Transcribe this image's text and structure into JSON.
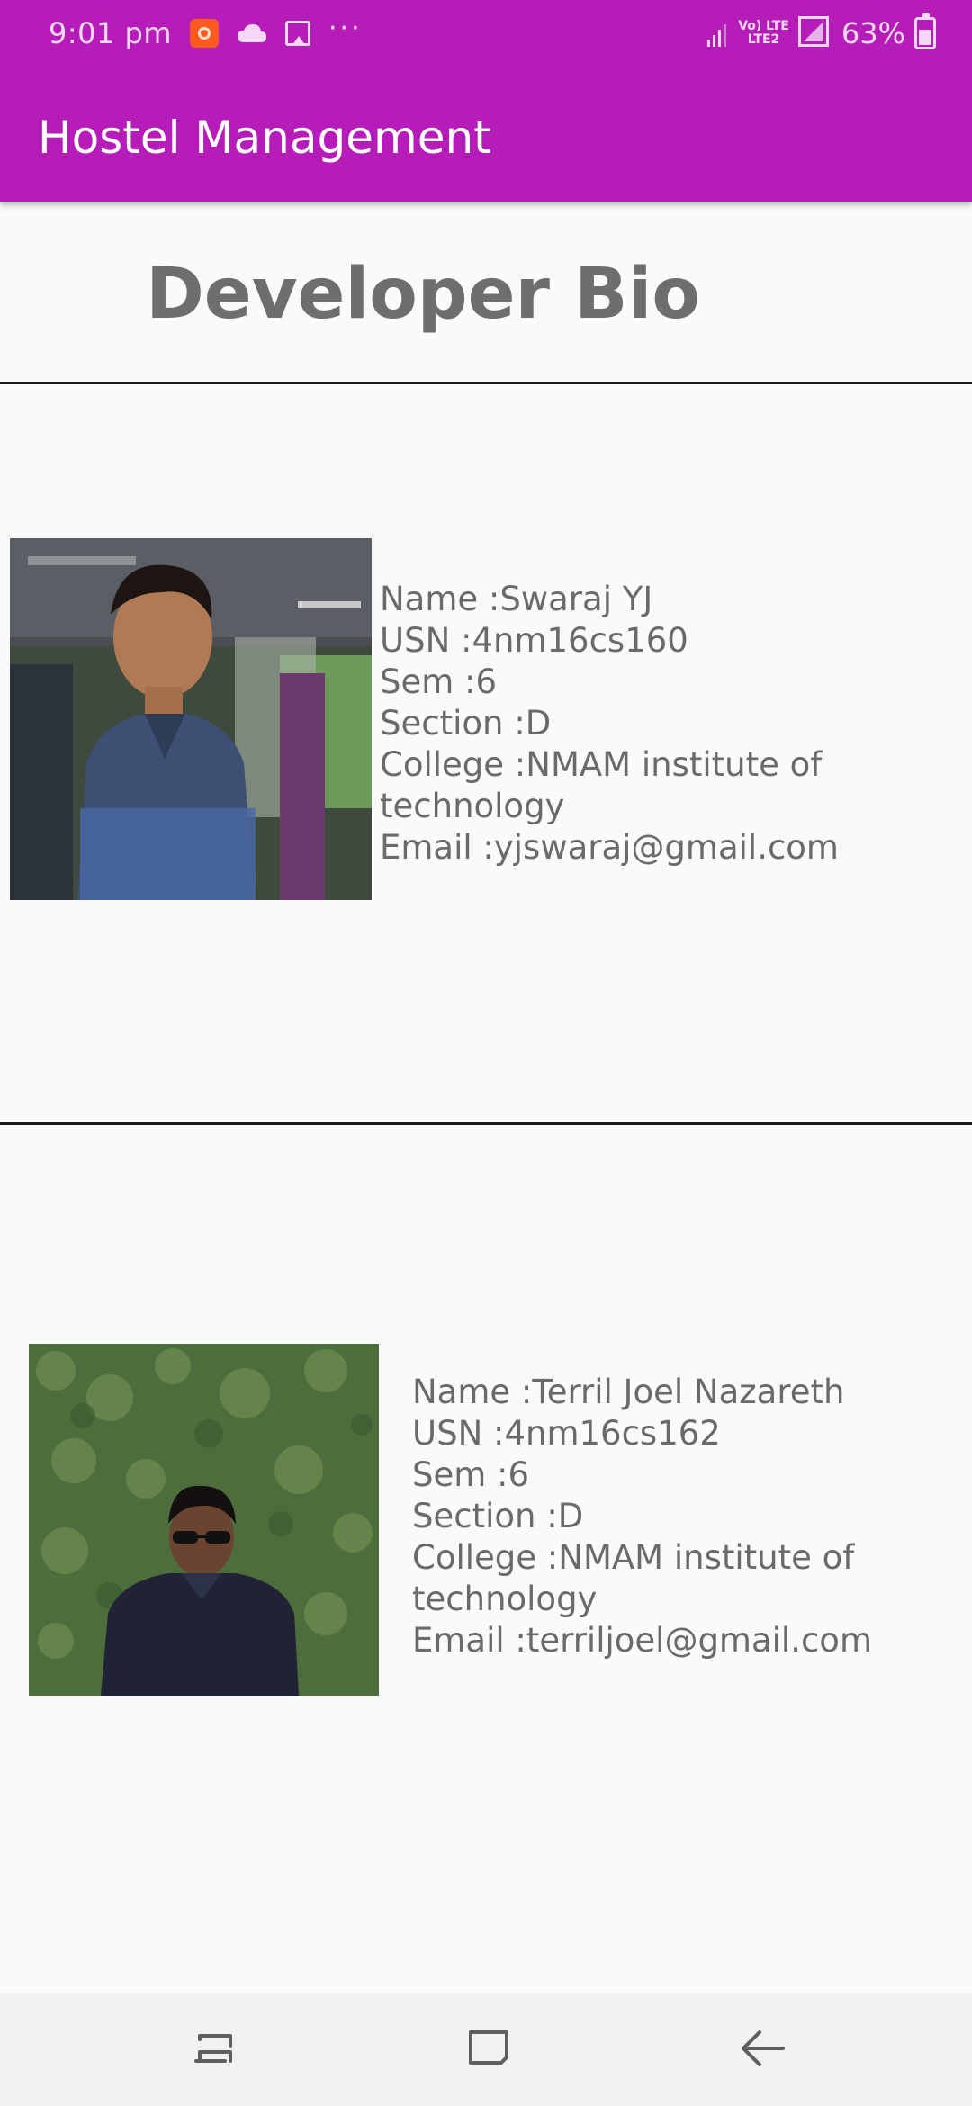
{
  "status_bar": {
    "time": "9:01 pm",
    "network_badge_top": "Vo) LTE",
    "network_badge_bottom": "LTE2",
    "battery": "63%",
    "icons": [
      "screen-record-icon",
      "cloud-icon",
      "gallery-icon",
      "more-dots-icon",
      "signal-icon",
      "battery-icon"
    ]
  },
  "app_bar": {
    "title": "Hostel Management"
  },
  "page": {
    "heading": "Developer Bio"
  },
  "developers": [
    {
      "name": "Name :Swaraj YJ",
      "usn": "USN :4nm16cs160",
      "sem": "Sem :6",
      "section": "Section :D",
      "college": "College :NMAM institute of technology",
      "email": "Email :yjswaraj@gmail.com"
    },
    {
      "name": "Name :Terril Joel Nazareth",
      "usn": "USN :4nm16cs162",
      "sem": "Sem :6",
      "section": "Section :D",
      "college": "College :NMAM institute of technology",
      "email": "Email :terriljoel@gmail.com"
    }
  ],
  "nav_bar": {
    "icons": [
      "recent-apps-icon",
      "home-icon",
      "back-icon"
    ]
  },
  "colors": {
    "primary": "#b51cb8",
    "background": "#fafafa",
    "text": "#6a6a6a",
    "nav_bar": "#f1f1f1"
  }
}
